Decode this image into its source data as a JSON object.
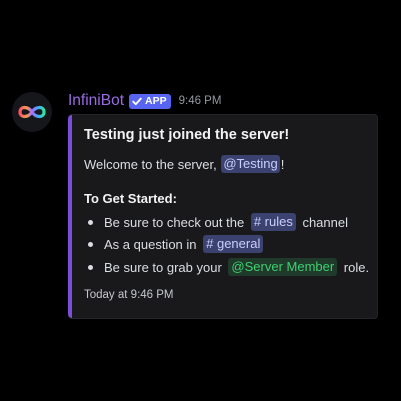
{
  "message": {
    "author": "InfiniBot",
    "badge": "APP",
    "timestamp": "9:46 PM",
    "avatar_icon": "infinity-logo-icon",
    "embed": {
      "accent_color": "#7c4ddc",
      "title": "Testing just joined the server!",
      "welcome_prefix": "Welcome to the server, ",
      "welcome_mention": "@Testing",
      "welcome_suffix": "!",
      "section_heading": "To Get Started:",
      "bullets": [
        {
          "before": "Be sure to check out the ",
          "mention": "# rules",
          "after": " channel"
        },
        {
          "before": "As a question in ",
          "mention": "# general",
          "after": ""
        },
        {
          "before": "Be sure to grab your ",
          "mention": "@Server Member",
          "after": " role."
        }
      ],
      "footer": "Today at 9:46 PM"
    }
  }
}
